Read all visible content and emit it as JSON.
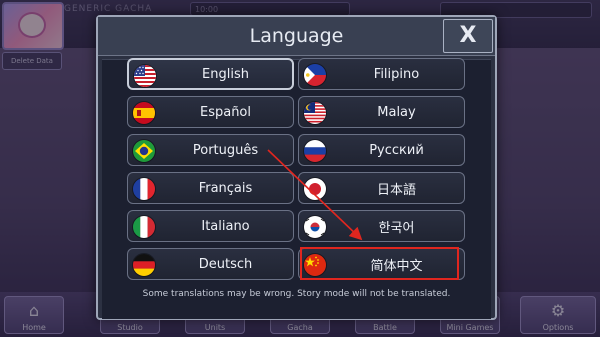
{
  "background": {
    "player_name": "GENERIC GACHA",
    "top_pill": "10:00",
    "delete_data_label": "Delete Data",
    "nav": [
      {
        "label": "Home",
        "icon": "home-icon"
      },
      {
        "label": "Studio",
        "icon": "studio-icon"
      },
      {
        "label": "Units",
        "icon": "units-icon"
      },
      {
        "label": "Gacha",
        "icon": "gacha-icon"
      },
      {
        "label": "Battle",
        "icon": "battle-icon"
      },
      {
        "label": "Mini Games",
        "icon": "mini-games-icon"
      },
      {
        "label": "Options",
        "icon": "gear-icon"
      }
    ]
  },
  "modal": {
    "title": "Language",
    "close_label": "X",
    "footnote": "Some translations may be wrong. Story mode will not be translated.",
    "selected": "English",
    "highlighted": "简体中文",
    "left_column": [
      {
        "label": "English",
        "flag": "us-flag-icon"
      },
      {
        "label": "Español",
        "flag": "spain-flag-icon"
      },
      {
        "label": "Português",
        "flag": "brazil-flag-icon"
      },
      {
        "label": "Français",
        "flag": "france-flag-icon"
      },
      {
        "label": "Italiano",
        "flag": "italy-flag-icon"
      },
      {
        "label": "Deutsch",
        "flag": "germany-flag-icon"
      }
    ],
    "right_column": [
      {
        "label": "Filipino",
        "flag": "philippines-flag-icon"
      },
      {
        "label": "Malay",
        "flag": "malaysia-flag-icon"
      },
      {
        "label": "Русский",
        "flag": "russia-flag-icon"
      },
      {
        "label": "日本語",
        "flag": "japan-flag-icon"
      },
      {
        "label": "한국어",
        "flag": "korea-flag-icon"
      },
      {
        "label": "简体中文",
        "flag": "china-flag-icon"
      }
    ]
  },
  "annotation": {
    "arrow_color": "#e0261f",
    "box_color": "#e0261f"
  }
}
